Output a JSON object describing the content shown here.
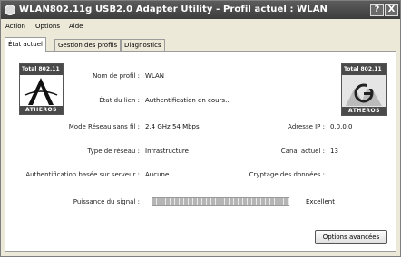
{
  "window": {
    "title": "WLAN802.11g USB2.0 Adapter Utility - Profil actuel : WLAN",
    "help_label": "?",
    "close_label": "X"
  },
  "menu": [
    "Action",
    "Options",
    "Aide"
  ],
  "tabs": [
    {
      "label": "État actuel",
      "active": true
    },
    {
      "label": "Gestion des profils",
      "active": false
    },
    {
      "label": "Diagnostics",
      "active": false
    }
  ],
  "logos": {
    "left_top": "Total 802.11",
    "left_brand": "ATHEROS",
    "right_top": "Total 802.11",
    "right_brand": "ATHEROS"
  },
  "status": {
    "profile_name_label": "Nom de profil :",
    "profile_name_value": "WLAN",
    "link_state_label": "État du lien :",
    "link_state_value": "Authentification en cours...",
    "wireless_mode_label": "Mode Réseau sans fil :",
    "wireless_mode_value": "2.4 GHz 54 Mbps",
    "ip_label": "Adresse IP :",
    "ip_value": "0.0.0.0",
    "network_type_label": "Type de réseau :",
    "network_type_value": "Infrastructure",
    "channel_label": "Canal actuel :",
    "channel_value": "13",
    "auth_label": "Authentification basée sur serveur :",
    "auth_value": "Aucune",
    "encryption_label": "Cryptage des données :",
    "encryption_value": "",
    "signal_label": "Puissance du signal :",
    "signal_level": 1.0,
    "signal_value": "Excellent"
  },
  "advanced_button_label": "Options avancées"
}
